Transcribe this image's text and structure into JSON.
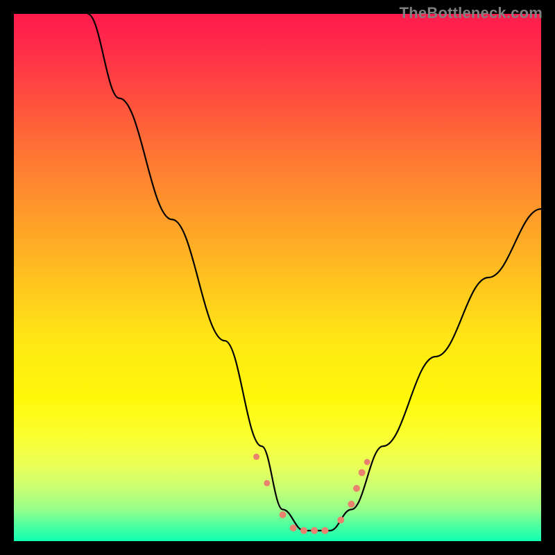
{
  "watermark": "TheBottleneck.com",
  "chart_data": {
    "type": "line",
    "title": "",
    "xlabel": "",
    "ylabel": "",
    "xlim": [
      0,
      100
    ],
    "ylim": [
      0,
      100
    ],
    "grid": false,
    "legend": false,
    "background_gradient": {
      "direction": "vertical",
      "stops": [
        {
          "pos": 0,
          "color": "#ff1b4c"
        },
        {
          "pos": 50,
          "color": "#ffd020"
        },
        {
          "pos": 80,
          "color": "#faff30"
        },
        {
          "pos": 100,
          "color": "#10ffb2"
        }
      ]
    },
    "series": [
      {
        "name": "bottleneck-curve",
        "x": [
          14,
          20,
          30,
          40,
          47,
          51,
          55,
          60,
          64,
          70,
          80,
          90,
          100
        ],
        "y": [
          100,
          84,
          61,
          38,
          18,
          6,
          2,
          2,
          6,
          18,
          35,
          50,
          63
        ],
        "stroke": "#000000"
      }
    ],
    "markers": [
      {
        "x": 46,
        "y": 16,
        "r": 4.5,
        "color": "#e9826f"
      },
      {
        "x": 48,
        "y": 11,
        "r": 4.5,
        "color": "#e9826f"
      },
      {
        "x": 51,
        "y": 5,
        "r": 5,
        "color": "#e9826f"
      },
      {
        "x": 53,
        "y": 2.5,
        "r": 5,
        "color": "#e9826f"
      },
      {
        "x": 55,
        "y": 2,
        "r": 5,
        "color": "#e9826f"
      },
      {
        "x": 57,
        "y": 2,
        "r": 5,
        "color": "#e9826f"
      },
      {
        "x": 59,
        "y": 2,
        "r": 5,
        "color": "#e9826f"
      },
      {
        "x": 62,
        "y": 4,
        "r": 5,
        "color": "#e9826f"
      },
      {
        "x": 64,
        "y": 7,
        "r": 5,
        "color": "#e9826f"
      },
      {
        "x": 65,
        "y": 10,
        "r": 5,
        "color": "#e9826f"
      },
      {
        "x": 66,
        "y": 13,
        "r": 5,
        "color": "#e9826f"
      },
      {
        "x": 67,
        "y": 15,
        "r": 4.5,
        "color": "#e9826f"
      }
    ]
  }
}
